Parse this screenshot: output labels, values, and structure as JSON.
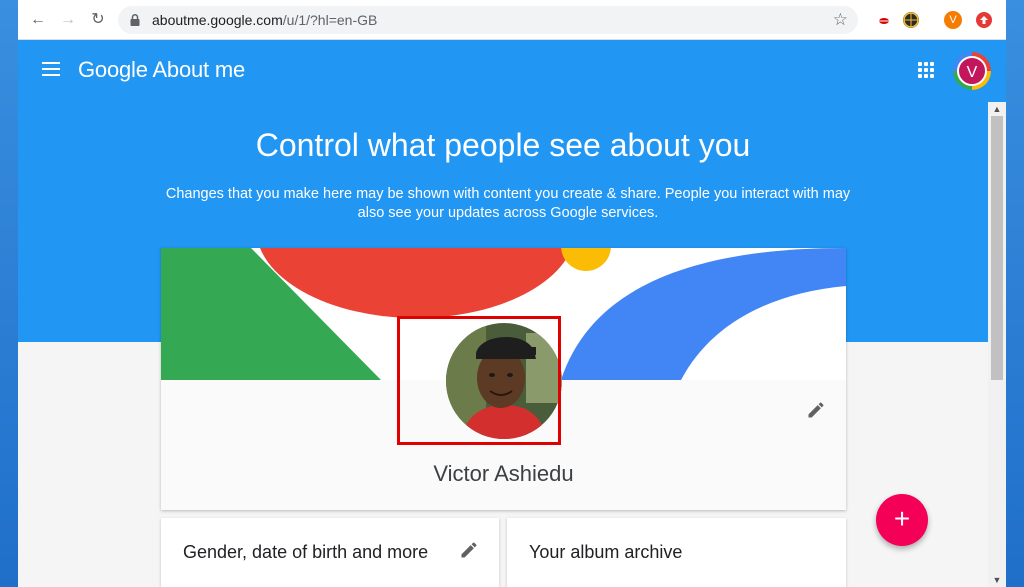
{
  "browser": {
    "url_host": "aboutme.google.com",
    "url_path": "/u/1/?hl=en-GB",
    "extension_avatar_letter": "V"
  },
  "appbar": {
    "brand_google": "Google",
    "brand_product": "About me",
    "account_letter": "V"
  },
  "hero": {
    "title": "Control what people see about you",
    "subtitle": "Changes that you make here may be shown with content you create & share. People you interact with may also see your updates across Google services."
  },
  "profile": {
    "name": "Victor Ashiedu"
  },
  "cards": {
    "gender_title": "Gender, date of birth and more",
    "album_title": "Your album archive"
  },
  "fab": {
    "label": "+"
  },
  "colors": {
    "appbar_blue": "#2196f3",
    "fab_pink": "#f50057",
    "highlight_red": "#e00000"
  }
}
